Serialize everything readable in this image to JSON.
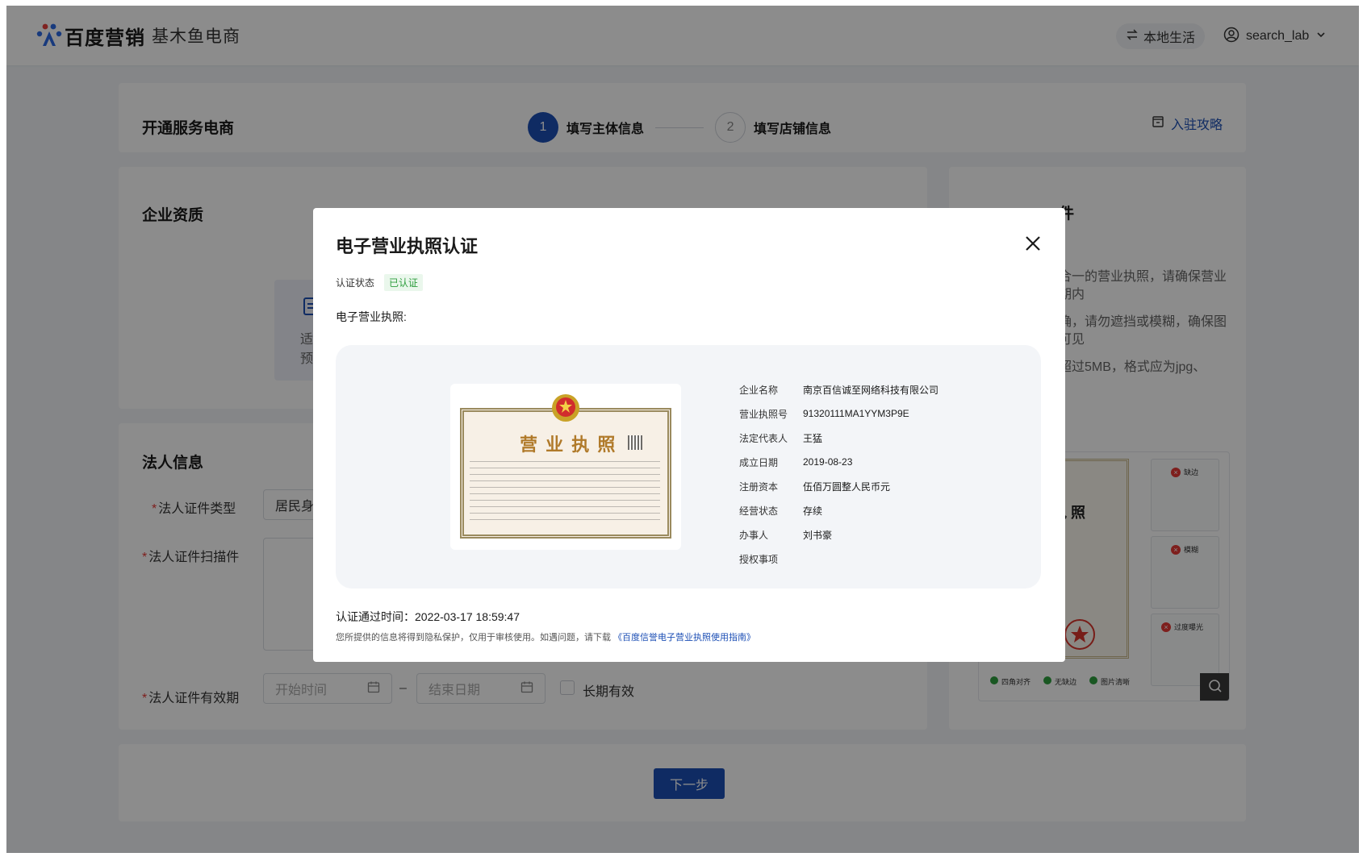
{
  "topbar": {
    "logo_text": "百度营销",
    "logo_sub": "基木鱼电商",
    "switch_label": "本地生活",
    "username": "search_lab"
  },
  "header_card": {
    "title": "开通服务电商",
    "steps": [
      {
        "number": "1",
        "label": "填写主体信息",
        "state": "active"
      },
      {
        "number": "2",
        "label": "填写店铺信息",
        "state": "todo"
      }
    ],
    "guide_link": "入驻攻略"
  },
  "enterprise_card": {
    "title": "企业资质",
    "upload_hint_line1": "适",
    "upload_hint_line2": "预"
  },
  "legal_card": {
    "title": "法人信息",
    "id_type_label": "法人证件类型",
    "id_type_value": "居民身",
    "scan_label": "法人证件扫描件",
    "validity_label": "法人证件有效期",
    "start_placeholder": "开始时间",
    "end_placeholder": "结束日期",
    "range_sep": "–",
    "long_term_label": "长期有效"
  },
  "guide_card": {
    "title_fragment": "件",
    "tips": [
      {
        "line1": "合一的营业执照，请确保营业",
        "line2": "期内"
      },
      {
        "line1": "确，请勿遮挡或模糊，确保图",
        "line2": "可见"
      },
      {
        "line1": "超过5MB，格式应为jpg、",
        "line2": ""
      }
    ],
    "illus_title": "执 照",
    "samples": [
      "缺边",
      "模糊",
      "过度曝光"
    ],
    "checks": [
      "四角对齐",
      "无缺边",
      "图片清晰"
    ]
  },
  "footer": {
    "next_label": "下一步"
  },
  "modal": {
    "title": "电子营业执照认证",
    "status_label": "认证状态",
    "status_value": "已认证",
    "license_label": "电子营业执照:",
    "cert_title": "营 业 执 照",
    "info": [
      {
        "key": "企业名称",
        "value": "南京百信诚至网络科技有限公司"
      },
      {
        "key": "营业执照号",
        "value": "91320111MA1YYM3P9E"
      },
      {
        "key": "法定代表人",
        "value": "王猛"
      },
      {
        "key": "成立日期",
        "value": "2019-08-23"
      },
      {
        "key": "注册资本",
        "value": "伍佰万圆整人民币元"
      },
      {
        "key": "经营状态",
        "value": "存续"
      },
      {
        "key": "办事人",
        "value": "刘书豪"
      },
      {
        "key": "授权事项",
        "value": ""
      }
    ],
    "pass_time": "认证通过时间：2022-03-17 18:59:47",
    "notice_text": "您所提供的信息将得到隐私保护，仅用于审核使用。如遇问题，请下载",
    "notice_link": "《百度信誉电子营业执照使用指南》"
  },
  "colors": {
    "primary": "#1d4fb5",
    "success": "#2e9e3e",
    "error": "#e53935",
    "page_bg": "#f3f5f8"
  }
}
